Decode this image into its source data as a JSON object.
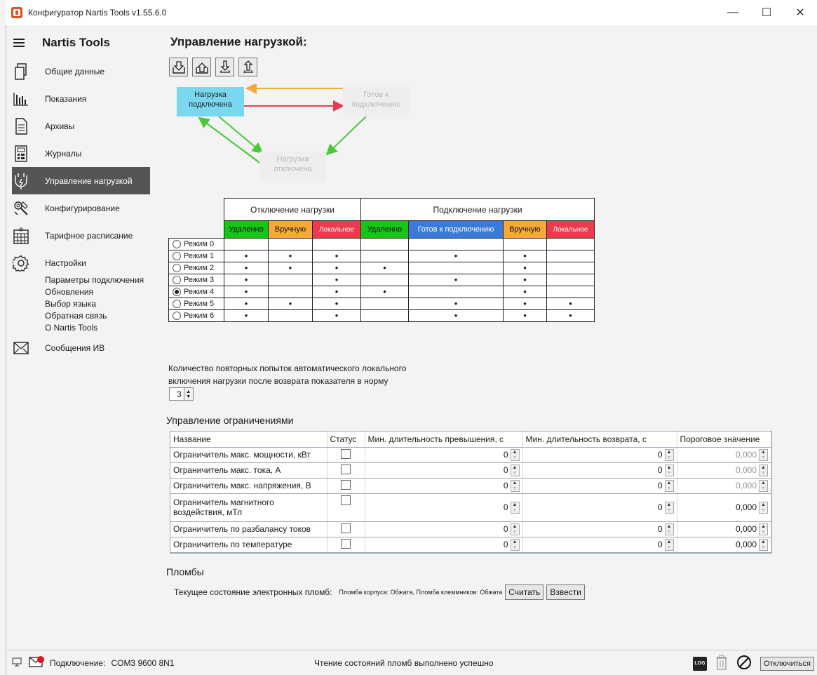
{
  "window": {
    "title": "Конфигуратор Nartis Tools v1.55.6.0"
  },
  "sidebar": {
    "brand": "Nartis Tools",
    "items": [
      {
        "label": "Общие данные",
        "icon": "document-icon"
      },
      {
        "label": "Показания",
        "icon": "bars-icon"
      },
      {
        "label": "Архивы",
        "icon": "archive-icon"
      },
      {
        "label": "Журналы",
        "icon": "journal-icon"
      },
      {
        "label": "Управление нагрузкой",
        "icon": "plug-icon",
        "active": true
      },
      {
        "label": "Конфигурирование",
        "icon": "tools-icon"
      },
      {
        "label": "Тарифное расписание",
        "icon": "calendar-icon"
      },
      {
        "label": "Настройки",
        "icon": "gear-icon"
      },
      {
        "label": "Сообщения ИВ",
        "icon": "envelope-icon"
      }
    ],
    "settings_sub": [
      "Параметры подключения",
      "Обновления",
      "Выбор языка",
      "Обратная связь",
      "О Nartis Tools"
    ]
  },
  "page": {
    "title": "Управление нагрузкой:"
  },
  "diagram": {
    "connected": "Нагрузка подключена",
    "ready": "Готов к подключению",
    "disconnected": "Нагрузка отключена",
    "colors": {
      "orange": "#f6a93b",
      "red": "#ec3a4e",
      "green": "#49c83a"
    }
  },
  "modes": {
    "groups": {
      "off": "Отключение нагрузки",
      "on": "Подключение нагрузки"
    },
    "columns": [
      "Удаленно",
      "Вручную",
      "Локальное",
      "Удаленно",
      "Готов к подключению",
      "Вручную",
      "Локальное"
    ],
    "rows": [
      {
        "label": "Режим 0",
        "selected": false,
        "marks": [
          0,
          0,
          0,
          0,
          0,
          0,
          0
        ]
      },
      {
        "label": "Режим 1",
        "selected": false,
        "marks": [
          1,
          1,
          1,
          0,
          1,
          1,
          0
        ]
      },
      {
        "label": "Режим 2",
        "selected": false,
        "marks": [
          1,
          1,
          1,
          1,
          0,
          1,
          0
        ]
      },
      {
        "label": "Режим 3",
        "selected": false,
        "marks": [
          1,
          0,
          1,
          0,
          1,
          1,
          0
        ]
      },
      {
        "label": "Режим 4",
        "selected": true,
        "marks": [
          1,
          0,
          1,
          1,
          0,
          1,
          0
        ]
      },
      {
        "label": "Режим 5",
        "selected": false,
        "marks": [
          1,
          1,
          1,
          0,
          1,
          1,
          1
        ]
      },
      {
        "label": "Режим 6",
        "selected": false,
        "marks": [
          1,
          0,
          1,
          0,
          1,
          1,
          1
        ]
      }
    ]
  },
  "retry": {
    "label_line1": "Количество повторных попыток автоматического локального",
    "label_line2": "включения нагрузки после возврата показателя в норму",
    "value": "3"
  },
  "limits": {
    "title": "Управление ограничениями",
    "headers": [
      "Название",
      "Статус",
      "Мин. длительность превышения, с",
      "Мин. длительность возврата, с",
      "Пороговое значение"
    ],
    "rows": [
      {
        "name": "Ограничитель макс. мощности, кВт",
        "exceed": "0",
        "ret": "0",
        "threshold": "0,000",
        "gray": true
      },
      {
        "name": "Ограничитель макс. тока, А",
        "exceed": "0",
        "ret": "0",
        "threshold": "0,000",
        "gray": true
      },
      {
        "name": "Ограничитель макс. напряжения, В",
        "exceed": "0",
        "ret": "0",
        "threshold": "0,000",
        "gray": true
      },
      {
        "name": "Ограничитель магнитного воздействия, мТл",
        "exceed": "0",
        "ret": "0",
        "threshold": "0,000",
        "gray": false
      },
      {
        "name": "Ограничитель по разбалансу токов",
        "exceed": "0",
        "ret": "0",
        "threshold": "0,000",
        "gray": false
      },
      {
        "name": "Ограничитель по температуре",
        "exceed": "0",
        "ret": "0",
        "threshold": "0,000",
        "gray": false
      }
    ]
  },
  "seals": {
    "title": "Пломбы",
    "label": "Текущее состояние электронных пломб:",
    "state": "Пломба корпуса: Обжата, Пломба клеммников: Обжата",
    "read_btn": "Считать",
    "arm_btn": "Взвести"
  },
  "statusbar": {
    "connection_label": "Подключение:",
    "connection_value": "COM3 9600 8N1",
    "message": "Чтение состояний пломб выполнено успешно",
    "log_icon": "LOG",
    "disconnect_btn": "Отключиться"
  }
}
